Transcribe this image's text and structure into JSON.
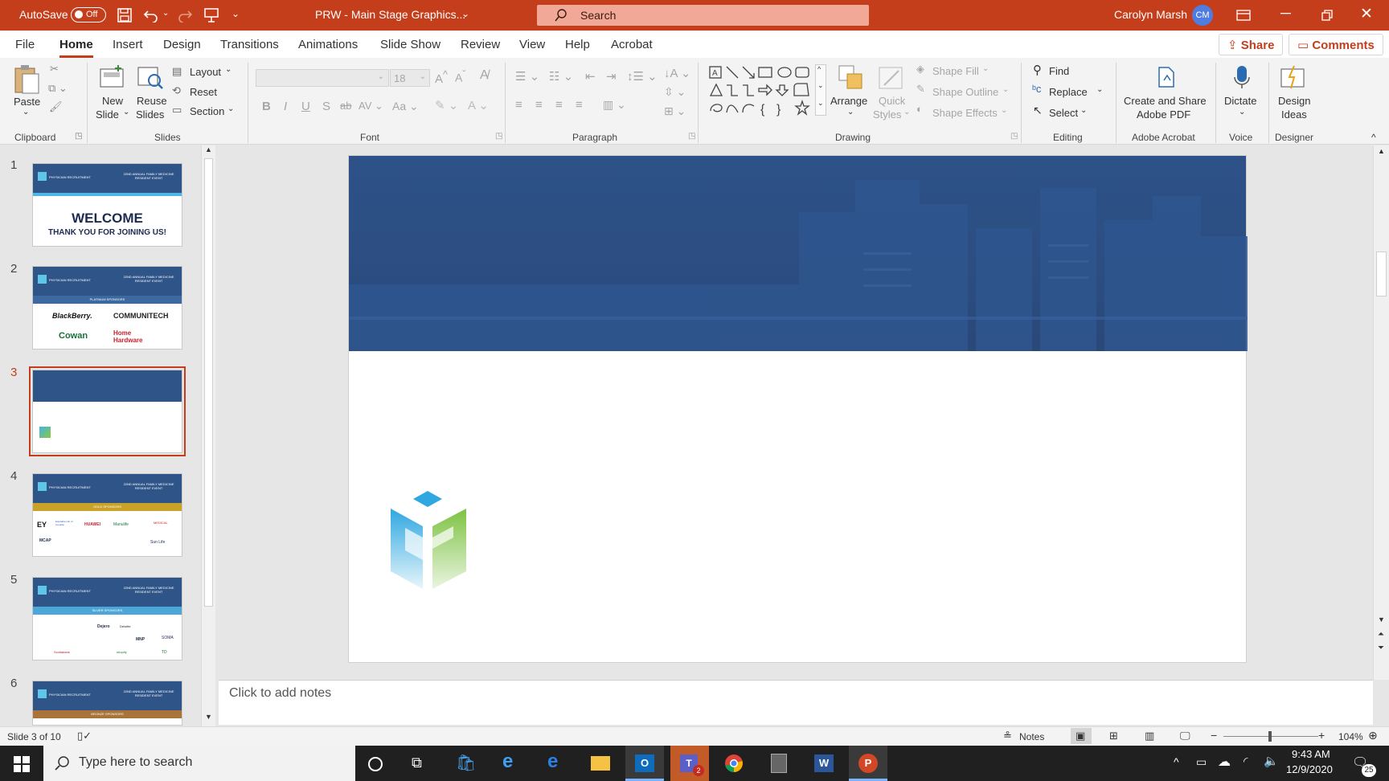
{
  "titlebar": {
    "autosave_label": "AutoSave",
    "autosave_state": "Off",
    "doc_title": "PRW - Main Stage Graphics...",
    "search_placeholder": "Search",
    "user_name": "Carolyn Marsh",
    "user_initials": "CM",
    "accent": "#c43e1c"
  },
  "menu": {
    "items": [
      "File",
      "Home",
      "Insert",
      "Design",
      "Transitions",
      "Animations",
      "Slide Show",
      "Review",
      "View",
      "Help",
      "Acrobat"
    ],
    "active": "Home",
    "share": "Share",
    "comments": "Comments"
  },
  "ribbon": {
    "clipboard": {
      "paste": "Paste",
      "group": "Clipboard"
    },
    "slides": {
      "new_slide_1": "New",
      "new_slide_2": "Slide",
      "reuse_1": "Reuse",
      "reuse_2": "Slides",
      "layout": "Layout",
      "reset": "Reset",
      "section": "Section",
      "group": "Slides"
    },
    "font": {
      "size": "18",
      "group": "Font"
    },
    "paragraph": {
      "group": "Paragraph"
    },
    "drawing": {
      "arrange": "Arrange",
      "quick_1": "Quick",
      "quick_2": "Styles",
      "shape_fill": "Shape Fill",
      "shape_outline": "Shape Outline",
      "shape_effects": "Shape Effects",
      "group": "Drawing"
    },
    "editing": {
      "find": "Find",
      "replace": "Replace",
      "select": "Select",
      "group": "Editing"
    },
    "acrobat": {
      "line1": "Create and Share",
      "line2": "Adobe PDF",
      "group": "Adobe Acrobat"
    },
    "voice": {
      "dictate": "Dictate",
      "group": "Voice"
    },
    "designer": {
      "line1": "Design",
      "line2": "Ideas",
      "group": "Designer"
    }
  },
  "slides": [
    {
      "num": "1",
      "header_right": "22ND ANNUAL FAMILY MEDICINE RESIDENT EVENT",
      "header_left": "PHYSICIAN RECRUITMENT",
      "title": "WELCOME",
      "subtitle": "THANK YOU FOR JOINING US!"
    },
    {
      "num": "2",
      "header_right": "22ND ANNUAL FAMILY MEDICINE RESIDENT EVENT",
      "header_left": "PHYSICIAN RECRUITMENT",
      "tier": "PLATINUM SPONSORS",
      "logos": [
        "BlackBerry.",
        "COMMUNITECH",
        "Cowan",
        "Home Hardware"
      ]
    },
    {
      "num": "3",
      "selected": true
    },
    {
      "num": "4",
      "header_right": "22ND ANNUAL FAMILY MEDICINE RESIDENT EVENT",
      "header_left": "PHYSICIAN RECRUITMENT",
      "tier": "GOLD SPONSORS",
      "logos": [
        "EY",
        "Equitable Life of Canada",
        "HUAWEI",
        "Manulife",
        "MEDICAL",
        "MCAP",
        "Sun Life"
      ]
    },
    {
      "num": "5",
      "header_right": "22ND ANNUAL FAMILY MEDICINE RESIDENT EVENT",
      "header_left": "PHYSICIAN RECRUITMENT",
      "tier": "SILVER SPONSORS",
      "logos": [
        "Dejero",
        "Deloitte",
        "MNP",
        "SOMA",
        "Scotiabank",
        "shopify",
        "TD"
      ]
    },
    {
      "num": "6",
      "header_right": "22ND ANNUAL FAMILY MEDICINE RESIDENT EVENT",
      "header_left": "PHYSICIAN RECRUITMENT",
      "tier": "BRONZE SPONSORS"
    }
  ],
  "notes_placeholder": "Click to add notes",
  "status": {
    "slide_count": "Slide 3 of 10",
    "notes": "Notes",
    "zoom": "104%"
  },
  "taskbar": {
    "search": "Type here to search",
    "time": "9:43 AM",
    "date": "12/9/2020",
    "notif": "25",
    "teams_badge": "2"
  }
}
